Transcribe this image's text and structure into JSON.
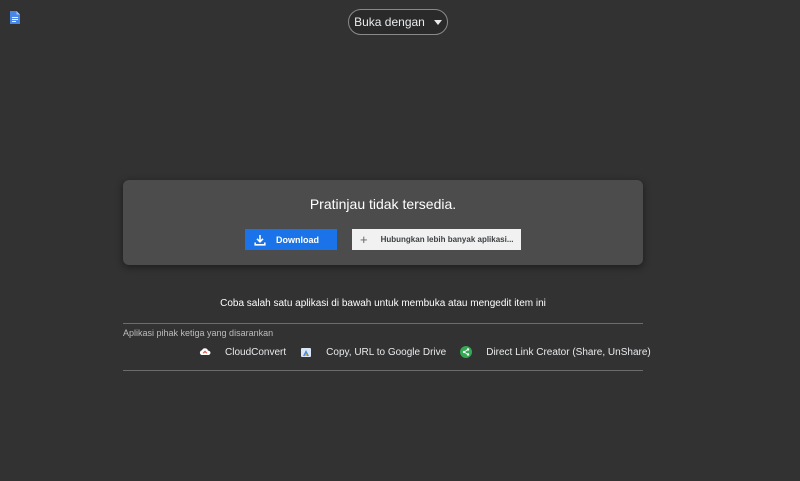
{
  "header": {
    "open_with_label": "Buka dengan"
  },
  "preview": {
    "message": "Pratinjau tidak tersedia.",
    "download_label": "Download",
    "connect_label": "Hubungkan lebih banyak aplikasi..."
  },
  "hint_text": "Coba salah satu aplikasi di bawah untuk membuka atau mengedit item ini",
  "suggested": {
    "label": "Aplikasi pihak ketiga yang disarankan",
    "apps": [
      {
        "name": "CloudConvert",
        "icon": "cloudconvert-icon"
      },
      {
        "name": "Copy, URL to Google Drive",
        "icon": "copy-url-drive-icon"
      },
      {
        "name": "Direct Link Creator (Share, UnShare)",
        "icon": "share-icon"
      }
    ]
  },
  "colors": {
    "background": "#323232",
    "card": "#4d4c4c",
    "primary": "#1a73e8"
  }
}
